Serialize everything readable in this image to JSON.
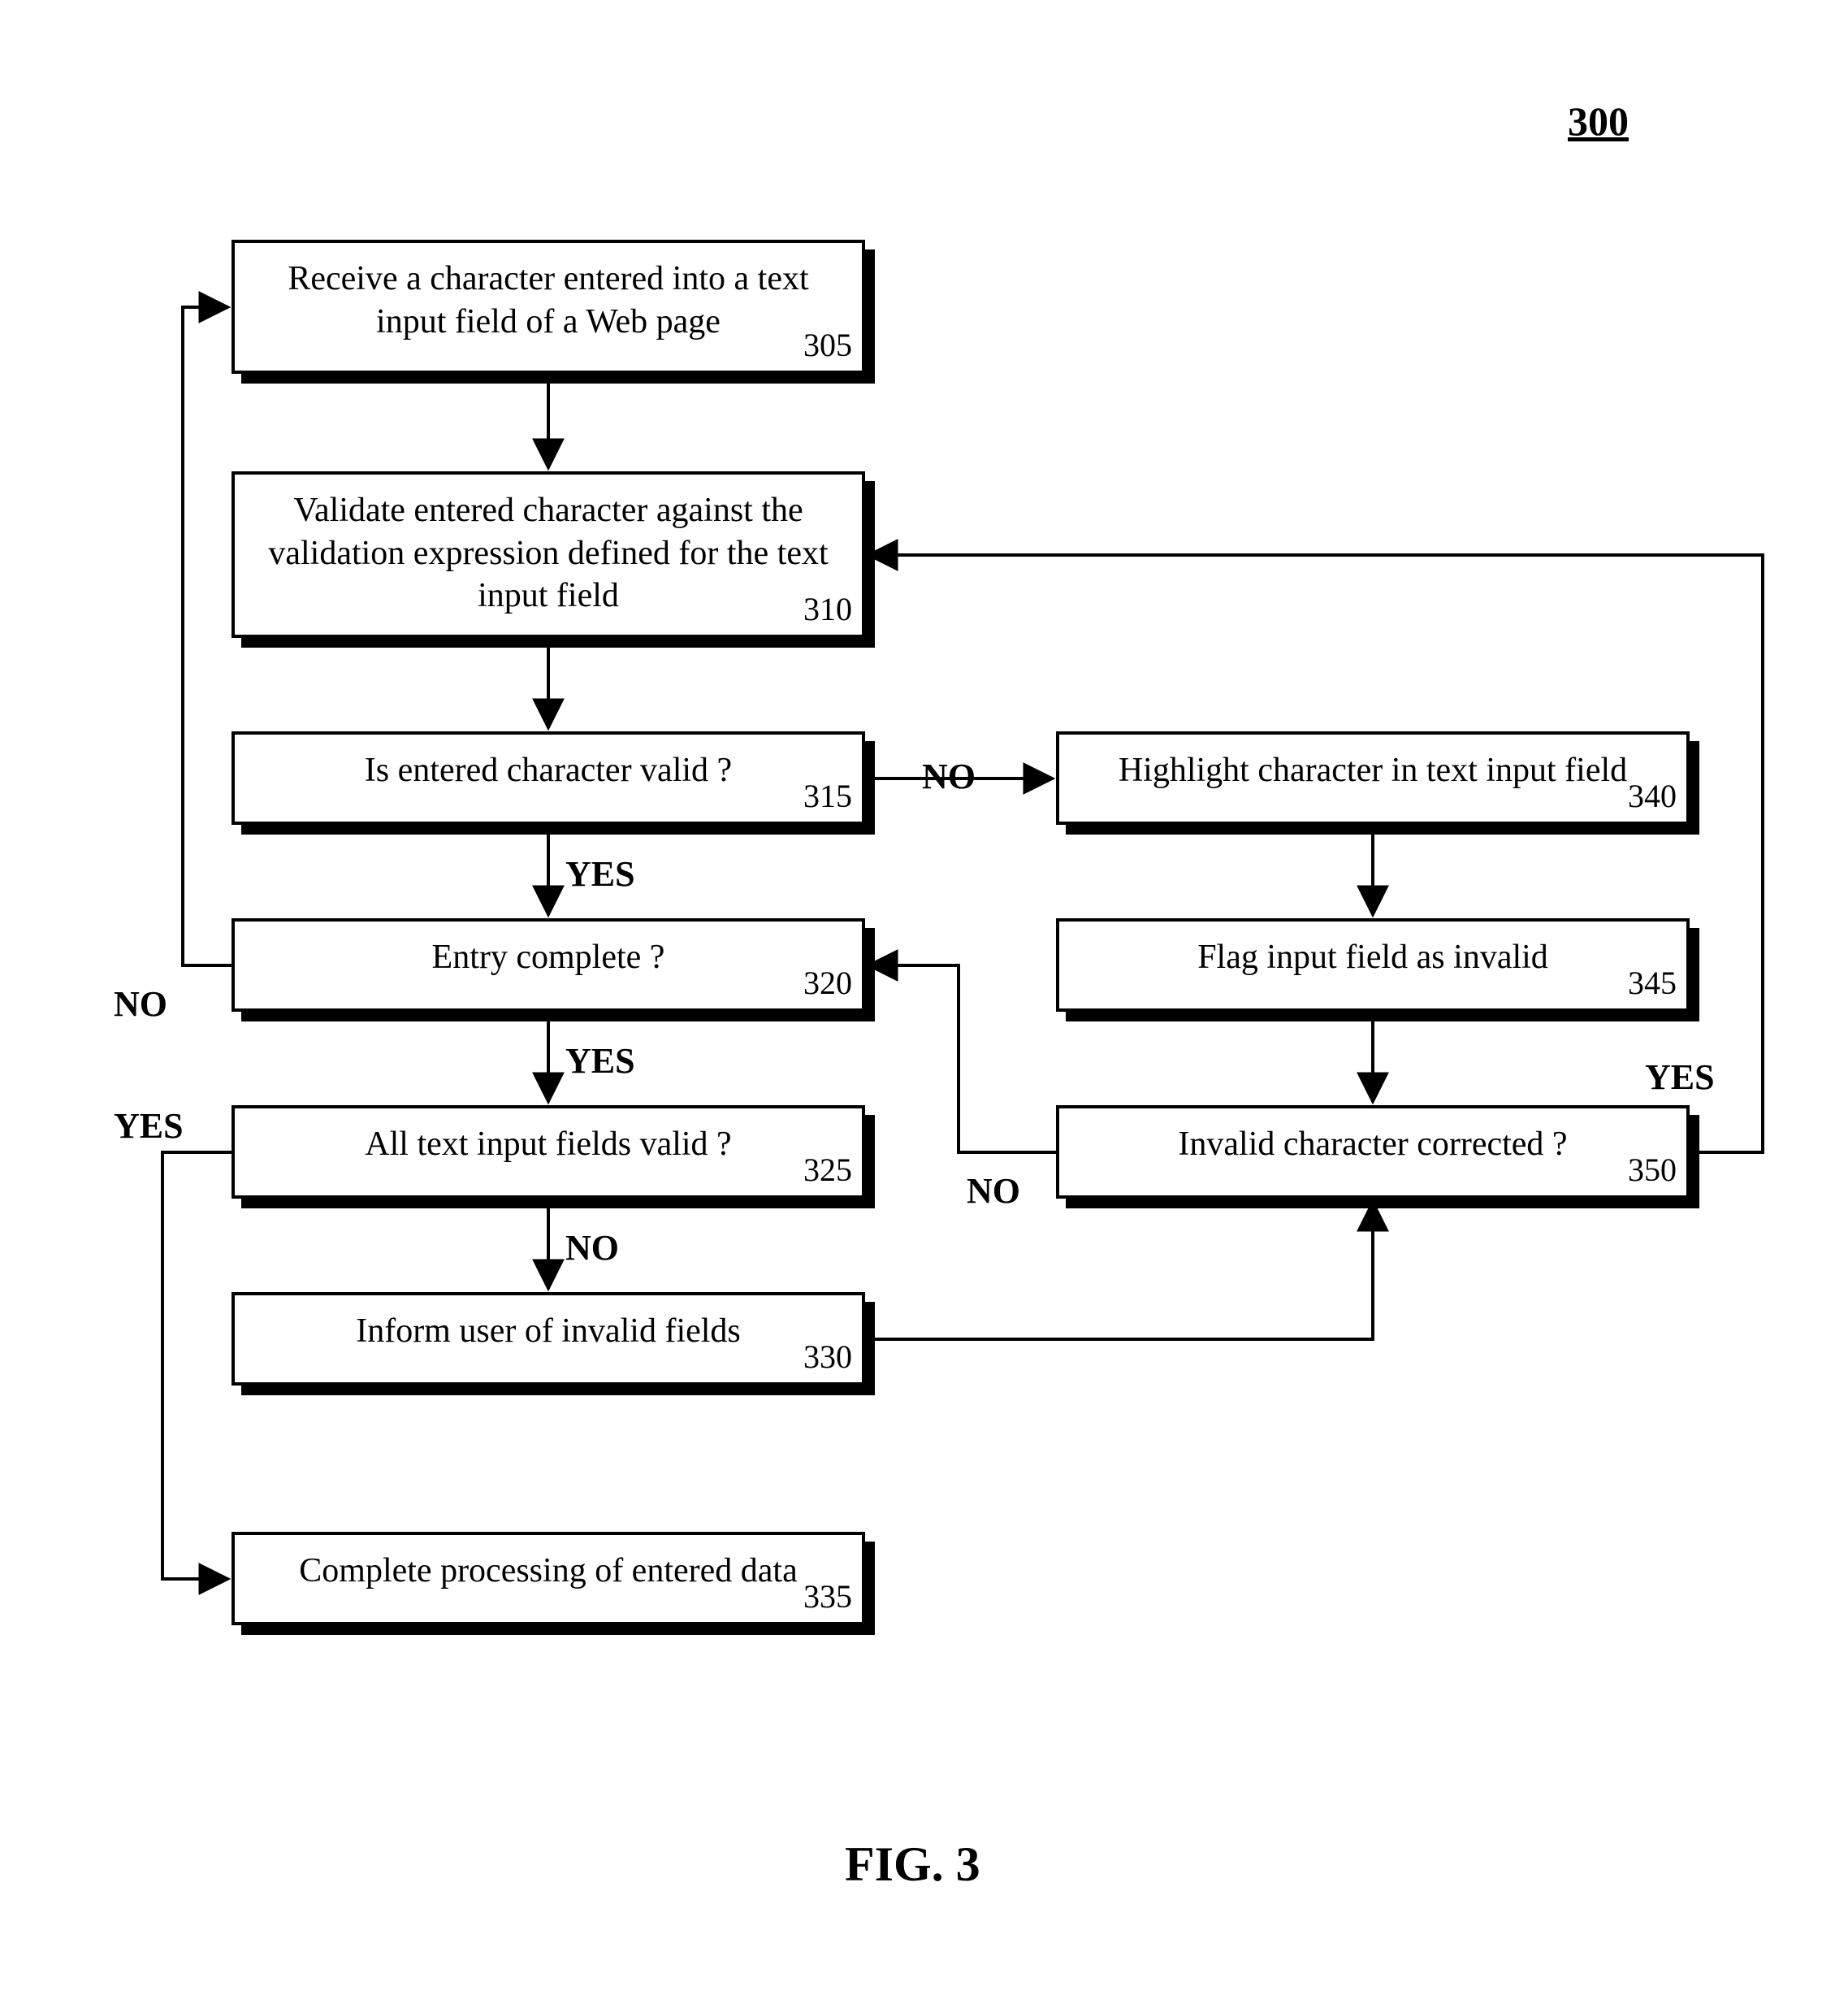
{
  "figureNumber": "300",
  "caption": "FIG. 3",
  "boxes": {
    "b305": {
      "text": "Receive a character entered into a text input field of a Web page",
      "num": "305"
    },
    "b310": {
      "text": "Validate entered character against the validation expression defined for the text input field",
      "num": "310"
    },
    "b315": {
      "text": "Is entered character valid ?",
      "num": "315"
    },
    "b320": {
      "text": "Entry complete ?",
      "num": "320"
    },
    "b325": {
      "text": "All text input fields valid ?",
      "num": "325"
    },
    "b330": {
      "text": "Inform user of invalid fields",
      "num": "330"
    },
    "b335": {
      "text": "Complete processing of entered data",
      "num": "335"
    },
    "b340": {
      "text": "Highlight character in text input field",
      "num": "340"
    },
    "b345": {
      "text": "Flag input field as invalid",
      "num": "345"
    },
    "b350": {
      "text": "Invalid character corrected ?",
      "num": "350"
    }
  },
  "labels": {
    "yes": "YES",
    "no": "NO"
  }
}
